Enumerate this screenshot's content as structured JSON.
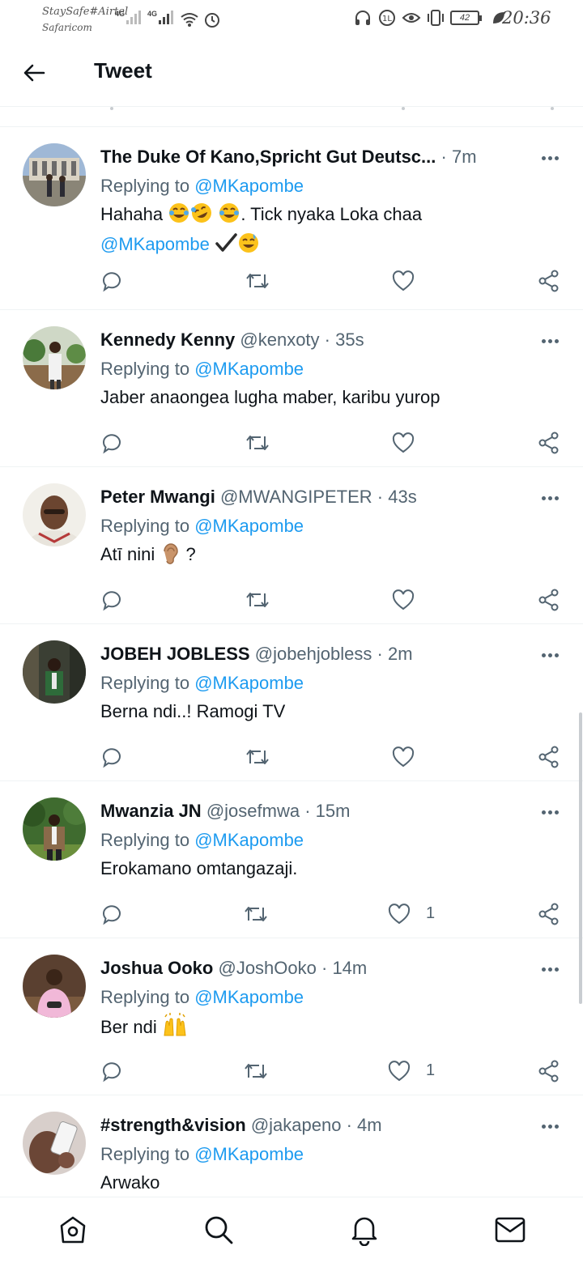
{
  "status_bar": {
    "carrier_line1": "StaySafe#Airtel",
    "carrier_line2": "Safaricom",
    "network_1": "4G",
    "network_2": "4G",
    "battery": "42",
    "time": "20:36"
  },
  "header": {
    "title": "Tweet"
  },
  "tweets": [
    {
      "name": "The Duke Of Kano,Spricht Gut Deutsc...",
      "handle": "",
      "time": "7m",
      "replying_label": "Replying to",
      "replying_to": "@MKapombe",
      "text": "Hahaha",
      "text_after_emoji": ". Tick nyaka Loka chaa",
      "text_mention": "@MKapombe",
      "likes": ""
    },
    {
      "name": "Kennedy Kenny",
      "handle": "@kenxoty",
      "time": "35s",
      "replying_label": "Replying to",
      "replying_to": "@MKapombe",
      "text": "Jaber anaongea lugha maber, karibu yurop",
      "likes": ""
    },
    {
      "name": "Peter Mwangi",
      "handle": "@MWANGIPETER",
      "time": "43s",
      "replying_label": "Replying to",
      "replying_to": "@MKapombe",
      "text": "Atī nini",
      "text_after_emoji": "?",
      "likes": ""
    },
    {
      "name": "JOBEH JOBLESS",
      "handle": "@jobehjobless",
      "time": "2m",
      "replying_label": "Replying to",
      "replying_to": "@MKapombe",
      "text": "Berna ndi..! Ramogi TV",
      "likes": ""
    },
    {
      "name": "Mwanzia JN",
      "handle": "@josefmwa",
      "time": "15m",
      "replying_label": "Replying to",
      "replying_to": "@MKapombe",
      "text": "Erokamano omtangazaji.",
      "likes": "1"
    },
    {
      "name": "Joshua Ooko",
      "handle": "@JoshOoko",
      "time": "14m",
      "replying_label": "Replying to",
      "replying_to": "@MKapombe",
      "text": "Ber ndi",
      "likes": "1"
    },
    {
      "name": "#strength&vision",
      "handle": "@jakapeno",
      "time": "4m",
      "replying_label": "Replying to",
      "replying_to": "@MKapombe",
      "text": "Arwako",
      "likes": ""
    }
  ],
  "icons": {
    "reply": "speech-bubble-icon",
    "retweet": "retweet-icon",
    "like": "heart-icon",
    "share": "share-icon",
    "more": "more-dots-icon"
  },
  "bottom_nav": [
    "home-icon",
    "search-icon",
    "notifications-bell-icon",
    "messages-envelope-icon"
  ],
  "colors": {
    "accent": "#1d9bf0",
    "secondary_text": "#536471",
    "primary_text": "#0f1419",
    "divider": "#eff3f4"
  }
}
